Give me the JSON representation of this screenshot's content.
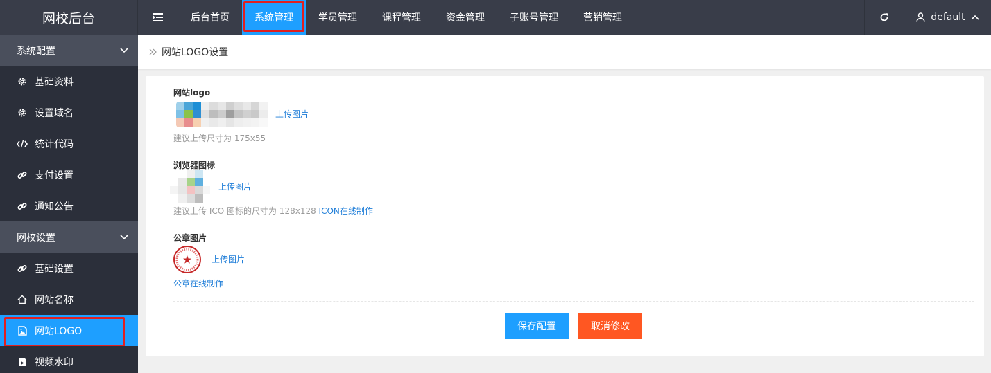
{
  "header": {
    "brand": "网校后台",
    "nav": [
      {
        "label": "后台首页",
        "active": false
      },
      {
        "label": "系统管理",
        "active": true
      },
      {
        "label": "学员管理",
        "active": false
      },
      {
        "label": "课程管理",
        "active": false
      },
      {
        "label": "资金管理",
        "active": false
      },
      {
        "label": "子账号管理",
        "active": false
      },
      {
        "label": "营销管理",
        "active": false
      }
    ],
    "user": "default"
  },
  "sidebar": {
    "group1": "系统配置",
    "group1_items": [
      "基础资料",
      "设置域名",
      "统计代码",
      "支付设置",
      "通知公告"
    ],
    "group2": "网校设置",
    "group2_items": [
      "基础设置",
      "网站名称",
      "网站LOGO",
      "视频水印"
    ]
  },
  "breadcrumb": "网站LOGO设置",
  "form": {
    "logo_label": "网站logo",
    "logo_upload": "上传图片",
    "logo_hint": "建议上传尺寸为 175x55",
    "favicon_label": "浏览器图标",
    "favicon_upload": "上传图片",
    "favicon_hint": "建议上传 ICO 图标的尺寸为 128x128",
    "favicon_link": "ICON在线制作",
    "seal_label": "公章图片",
    "seal_upload": "上传图片",
    "seal_link": "公章在线制作",
    "save_label": "保存配置",
    "cancel_label": "取消修改"
  },
  "colors": {
    "topbar": "#393d49",
    "active": "#1e9fff",
    "save": "#1e9fff",
    "cancel": "#ff5722",
    "highlight": "#e02020",
    "link": "#1e7dd8"
  }
}
